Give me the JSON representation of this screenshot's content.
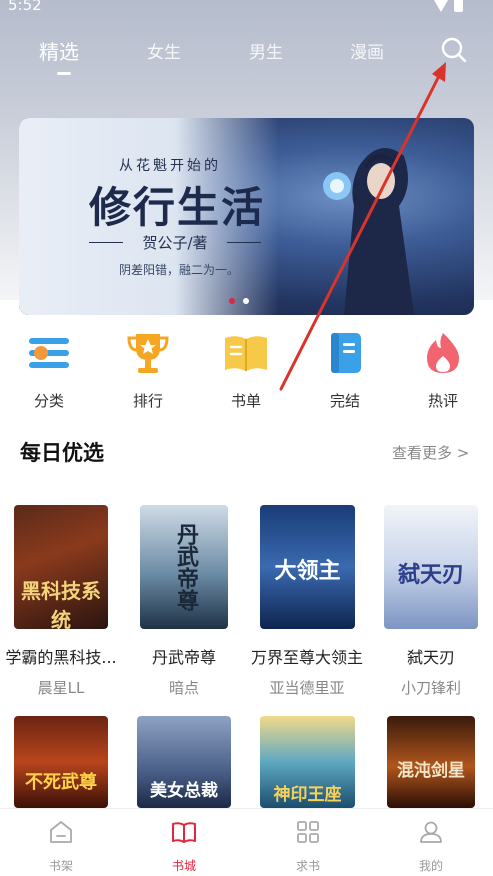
{
  "status": {
    "time": "5:52"
  },
  "top_tabs": [
    "精选",
    "女生",
    "男生",
    "漫画"
  ],
  "banner": {
    "subtitle": "从花魁开始的",
    "title": "修行生活",
    "author": "贺公子/著",
    "desc": "阴差阳错，融二为一。"
  },
  "quick_nav": [
    {
      "label": "分类",
      "icon": "category-icon"
    },
    {
      "label": "排行",
      "icon": "trophy-icon"
    },
    {
      "label": "书单",
      "icon": "book-open-icon"
    },
    {
      "label": "完结",
      "icon": "finished-book-icon"
    },
    {
      "label": "热评",
      "icon": "flame-icon"
    }
  ],
  "section": {
    "title": "每日优选",
    "more": "查看更多 >"
  },
  "books_row1": [
    {
      "title": "学霸的黑科技...",
      "author": "晨星LL",
      "cover_text": "黑科技系统"
    },
    {
      "title": "丹武帝尊",
      "author": "暗点",
      "cover_text": "丹武帝尊"
    },
    {
      "title": "万界至尊大领主",
      "author": "亚当德里亚",
      "cover_text": "大领主"
    },
    {
      "title": "弑天刃",
      "author": "小刀锋利",
      "cover_text": "弑天刃"
    }
  ],
  "books_row2": [
    {
      "cover_text": "不死武尊"
    },
    {
      "cover_text": "美女总裁"
    },
    {
      "cover_text": "神印王座"
    },
    {
      "cover_text": "混沌剑星"
    }
  ],
  "bottom_nav": [
    {
      "label": "书架",
      "icon": "bookshelf-icon"
    },
    {
      "label": "书城",
      "icon": "bookstore-icon"
    },
    {
      "label": "求书",
      "icon": "grid-icon"
    },
    {
      "label": "我的",
      "icon": "profile-icon"
    }
  ],
  "colors": {
    "accent": "#e2263e",
    "annotation_arrow": "#d9342b"
  }
}
